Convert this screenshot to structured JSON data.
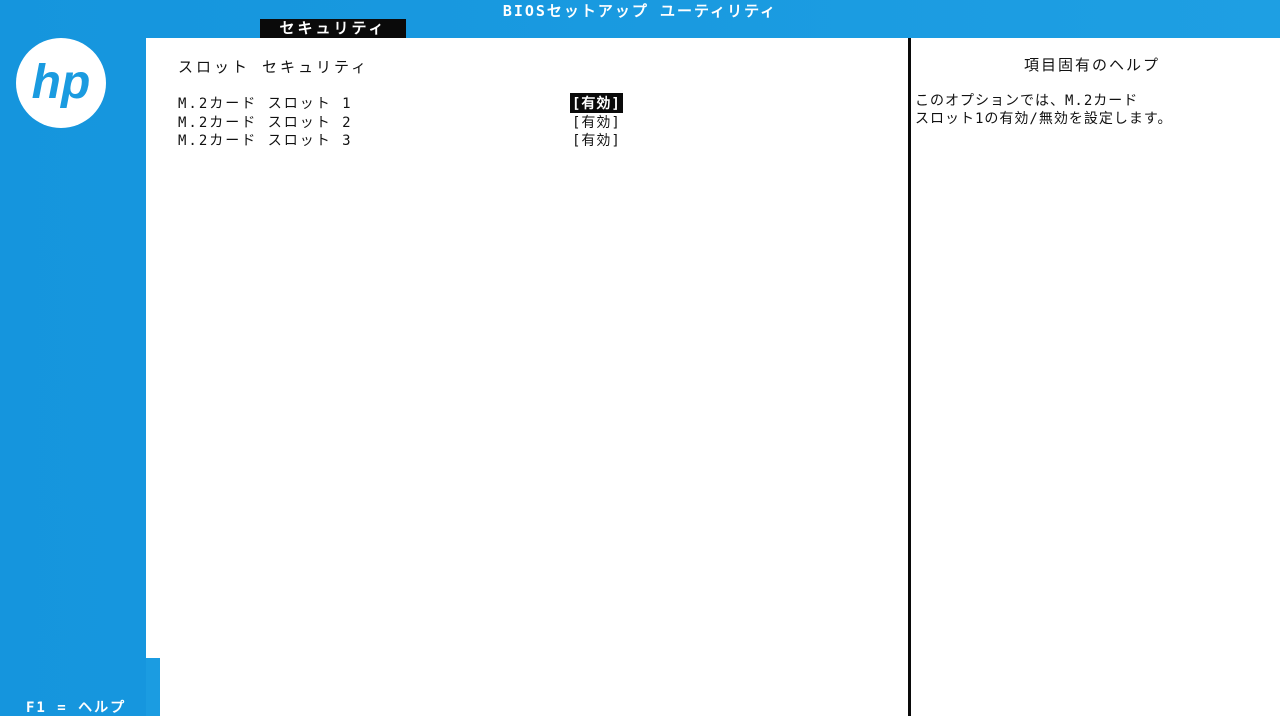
{
  "header": {
    "title": "BIOSセットアップ ユーティリティ",
    "active_tab": "セキュリティ"
  },
  "brand": {
    "logo_text": "hp"
  },
  "main": {
    "section_title": "スロット セキュリティ",
    "settings": [
      {
        "label": "M.2カード スロット 1",
        "value": "[有効]",
        "selected": true
      },
      {
        "label": "M.2カード スロット 2",
        "value": "[有効]",
        "selected": false
      },
      {
        "label": "M.2カード スロット 3",
        "value": "[有効]",
        "selected": false
      }
    ]
  },
  "help": {
    "title": "項目固有のヘルプ",
    "lines": [
      "このオプションでは、M.2カード",
      "スロット1の有効/無効を設定します。"
    ]
  },
  "footer": {
    "f1_help": "F1 = ヘルプ"
  },
  "colors": {
    "background": "#1a9be0",
    "panel": "#ffffff",
    "highlight": "#0a0a0a"
  }
}
